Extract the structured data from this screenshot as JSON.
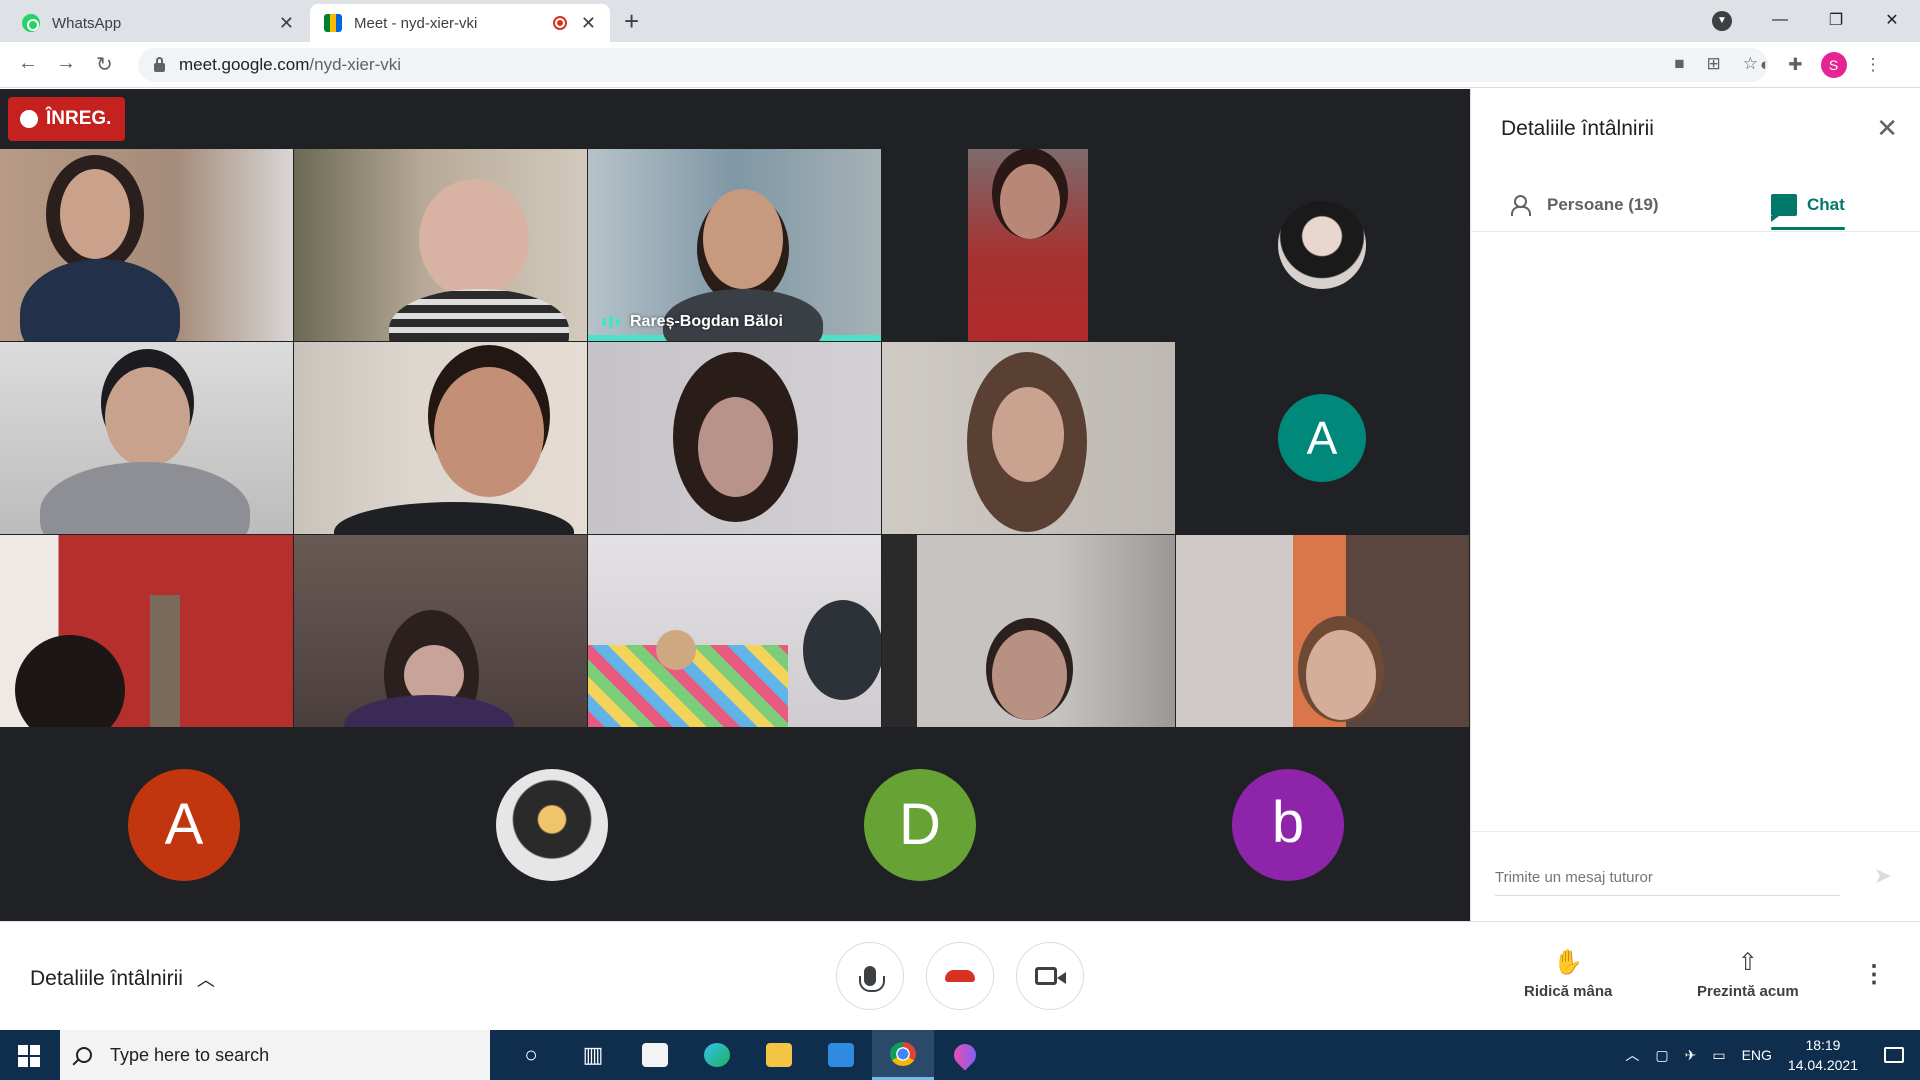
{
  "browser": {
    "tabs": [
      {
        "title": "WhatsApp",
        "icon": "whatsapp-icon"
      },
      {
        "title": "Meet - nyd-xier-vki",
        "icon": "google-meet-icon",
        "active": true,
        "recording": true
      }
    ],
    "url_host": "meet.google.com",
    "url_path": "/nyd-xier-vki",
    "profile_initial": "S"
  },
  "meet": {
    "recording_label": "ÎNREG.",
    "speaker_name": "Rareș-Bogdan Băloi",
    "avatar_letters": {
      "a_teal": "A",
      "a_red": "A",
      "d_green": "D",
      "b_purple": "b"
    },
    "colors": {
      "teal": "#00897b",
      "red": "#c1360f",
      "green": "#66a234",
      "purple": "#8e24aa"
    }
  },
  "panel": {
    "title": "Detaliile întâlnirii",
    "people_tab": "Persoane (19)",
    "chat_tab": "Chat",
    "message_placeholder": "Trimite un mesaj tuturor"
  },
  "controls": {
    "meeting_details": "Detaliile întâlnirii",
    "raise_hand": "Ridică mâna",
    "present_now": "Prezintă acum"
  },
  "taskbar": {
    "search_placeholder": "Type here to search",
    "language": "ENG",
    "time": "18:19",
    "date": "14.04.2021"
  }
}
